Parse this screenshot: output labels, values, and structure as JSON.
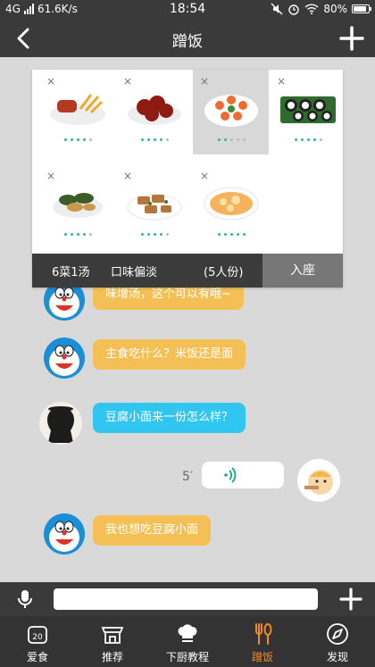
{
  "status": {
    "network": "4G",
    "speed": "61.6K/s",
    "time": "18:54",
    "battery": "80%"
  },
  "header": {
    "title": "蹭饭"
  },
  "menu": {
    "dishes": [
      {
        "name": "sausage-fries-icon"
      },
      {
        "name": "braised-pork-icon"
      },
      {
        "name": "shrimp-platter-icon",
        "selected": true
      },
      {
        "name": "sushi-roll-icon"
      },
      {
        "name": "stir-fry-vegetables-icon"
      },
      {
        "name": "stir-fry-meat-icon"
      },
      {
        "name": "egg-soup-icon"
      }
    ],
    "remove_glyph": "×",
    "summary": "6菜1汤",
    "taste": "口味偏淡",
    "people": "(5人份)",
    "seat_label": "入座"
  },
  "messages": [
    {
      "text": "味增汤，这个可以有哦~",
      "style": "orange",
      "sender": "doraemon"
    },
    {
      "text": "主食吃什么？米饭还是面",
      "style": "orange",
      "sender": "doraemon"
    },
    {
      "text": "豆腐小面来一份怎么样？",
      "style": "blue",
      "sender": "woman-silhouette"
    },
    {
      "duration": "5′",
      "style": "voice",
      "sender": "cartoon-boy"
    },
    {
      "text": "我也想吃豆腐小面",
      "style": "orange",
      "sender": "doraemon"
    }
  ],
  "tabs": [
    {
      "label": "爱食",
      "icon": "calendar-20-icon",
      "badge": "20"
    },
    {
      "label": "推荐",
      "icon": "shop-icon"
    },
    {
      "label": "下厨教程",
      "icon": "chef-hat-icon"
    },
    {
      "label": "蹭饭",
      "icon": "fork-spoon-icon",
      "active": true
    },
    {
      "label": "发现",
      "icon": "compass-icon"
    }
  ],
  "colors": {
    "accent": "#f08a24",
    "bubble_orange": "#f4c055",
    "bubble_blue": "#31c6ef",
    "dot_green": "#2cb89a",
    "bar": "#3a3a3a"
  }
}
